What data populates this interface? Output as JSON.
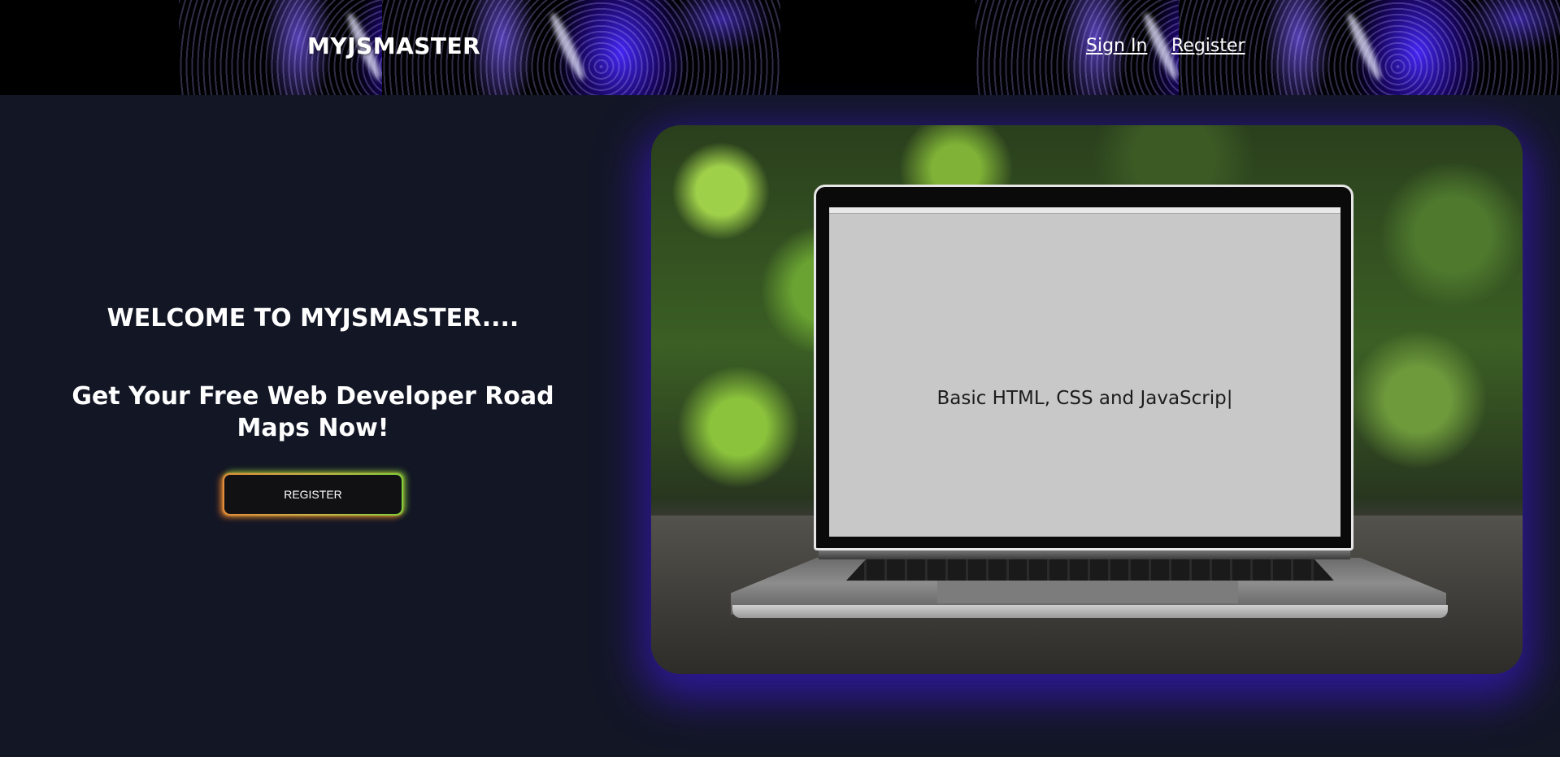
{
  "header": {
    "brand": "MYJSMASTER",
    "nav": {
      "sign_in": "Sign In",
      "register": "Register"
    }
  },
  "hero": {
    "welcome": "WELCOME TO MYJSMASTER....",
    "subtitle": "Get Your Free Web Developer Road Maps Now!",
    "cta_label": "REGISTER",
    "image": {
      "typed_text": "Basic HTML, CSS and JavaScrip|"
    }
  },
  "colors": {
    "page_bg": "#131625",
    "header_bg": "#000000",
    "accent_glow": "#3719be",
    "cta_gradient_left": "#e58a3a",
    "cta_gradient_right": "#7fcf3a"
  }
}
